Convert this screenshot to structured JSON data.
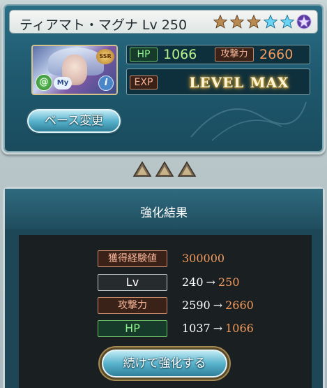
{
  "card": {
    "title": "ティアマト・マグナ Lv 250",
    "stars": [
      "bronze",
      "bronze",
      "bronze",
      "blue",
      "blue",
      "purple"
    ],
    "portrait": {
      "rarity": "SSR",
      "my_label": "My",
      "info_label": "i",
      "element_glyph": "@"
    },
    "hp_label": "HP",
    "hp_value": "1066",
    "atk_label": "攻撃力",
    "atk_value": "2660",
    "exp_label": "EXP",
    "exp_status": "LEVEL MAX",
    "base_change_label": "ベース変更"
  },
  "result": {
    "title": "強化結果",
    "rows": [
      {
        "label": "獲得経験値",
        "style": "exp",
        "old": "",
        "arrow": "",
        "new": "300000"
      },
      {
        "label": "Lv",
        "style": "lv",
        "old": "240",
        "arrow": "→",
        "new": "250"
      },
      {
        "label": "攻撃力",
        "style": "atk",
        "old": "2590",
        "arrow": "→",
        "new": "2660"
      },
      {
        "label": "HP",
        "style": "hp",
        "old": "1037",
        "arrow": "→",
        "new": "1066"
      }
    ],
    "continue_label": "続けて強化する"
  },
  "colors": {
    "accent_orange": "#f39a5c",
    "hp_green": "#b9f28a",
    "panel_teal": "#1d4656"
  }
}
